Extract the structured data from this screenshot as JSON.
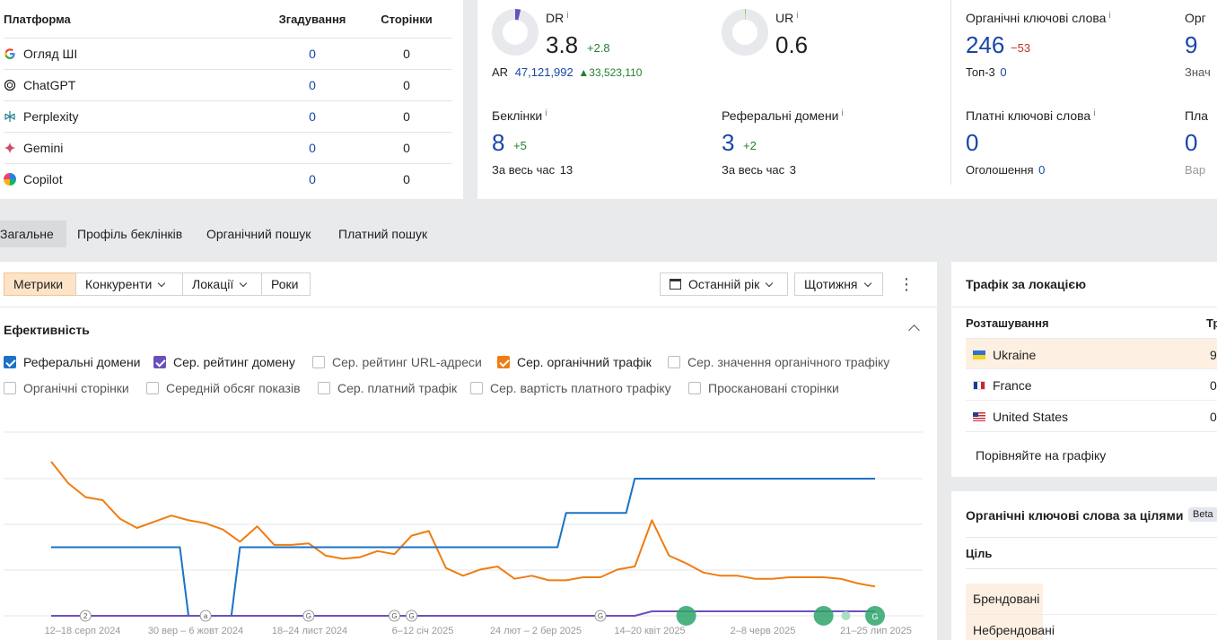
{
  "platforms": {
    "headers": [
      "Платформа",
      "Згадування",
      "Сторінки"
    ],
    "rows": [
      {
        "name": "Огляд ШІ",
        "icon": "google-icon",
        "mentions": "0",
        "pages": "0"
      },
      {
        "name": "ChatGPT",
        "icon": "chatgpt-icon",
        "mentions": "0",
        "pages": "0"
      },
      {
        "name": "Perplexity",
        "icon": "perplexity-icon",
        "mentions": "0",
        "pages": "0"
      },
      {
        "name": "Gemini",
        "icon": "gemini-icon",
        "mentions": "0",
        "pages": "0"
      },
      {
        "name": "Copilot",
        "icon": "copilot-icon",
        "mentions": "0",
        "pages": "0"
      }
    ]
  },
  "metrics": {
    "dr": {
      "label": "DR",
      "info": "i",
      "value": "3.8",
      "delta": "+2.8",
      "fill": 0.038
    },
    "ar": {
      "label": "AR",
      "value": "47,121,992",
      "delta": "▲33,523,110"
    },
    "ur": {
      "label": "UR",
      "info": "i",
      "value": "0.6",
      "fill": 0.006
    },
    "backlinks": {
      "label": "Беклінки",
      "info": "i",
      "value": "8",
      "delta": "+5",
      "sub_label": "За весь час",
      "sub_value": "13"
    },
    "ref_domains": {
      "label": "Реферальні домени",
      "info": "i",
      "value": "3",
      "delta": "+2",
      "sub_label": "За весь час",
      "sub_value": "3"
    },
    "organic_kw": {
      "label": "Органічні ключові слова",
      "info": "i",
      "value": "246",
      "delta": "−53",
      "sub_label": "Топ-3",
      "sub_value": "0"
    },
    "organic_cut": {
      "label": "Орг",
      "value": "9",
      "sub_label": "Знач"
    },
    "paid_kw": {
      "label": "Платні ключові слова",
      "info": "i",
      "value": "0",
      "sub_label": "Оголошення",
      "sub_value": "0"
    },
    "paid_cut": {
      "label": "Пла",
      "value": "0",
      "sub_label": "Вар"
    }
  },
  "tabs": [
    "Загальне",
    "Профіль беклінків",
    "Органічний пошук",
    "Платний пошук"
  ],
  "toolbar": {
    "segments": [
      "Метрики",
      "Конкуренти",
      "Локації",
      "Роки"
    ],
    "period": "Останній рік",
    "interval": "Щотижня"
  },
  "performance": {
    "title": "Ефективність",
    "checkboxes": [
      {
        "label": "Реферальні домени",
        "checked": true,
        "color": "#1a73c8"
      },
      {
        "label": "Сер. рейтинг домену",
        "checked": true,
        "color": "#6c4fbd"
      },
      {
        "label": "Сер. рейтинг URL-адреси",
        "checked": false
      },
      {
        "label": "Сер. органічний трафік",
        "checked": true,
        "color": "#f07c12"
      },
      {
        "label": "Сер. значення органічного трафіку",
        "checked": false
      },
      {
        "label": "Органічні сторінки",
        "checked": false
      },
      {
        "label": "Середній обсяг показів",
        "checked": false
      },
      {
        "label": "Сер. платний трафік",
        "checked": false
      },
      {
        "label": "Сер. вартість платного трафіку",
        "checked": false
      },
      {
        "label": "Проскановані сторінки",
        "checked": false
      }
    ]
  },
  "chart_data": {
    "type": "line",
    "x_tick_labels": [
      "12–18 серп 2024",
      "30 вер – 6 жовт 2024",
      "18–24 лист 2024",
      "6–12 січ 2025",
      "24 лют – 2 бер 2025",
      "14–20 квіт 2025",
      "2–8 черв 2025",
      "21–25 лип 2025"
    ],
    "grid": true,
    "series": [
      {
        "name": "Сер. органічний трафік",
        "color": "#f07c12",
        "values": [
          100,
          86,
          77,
          75,
          63,
          57,
          61,
          65,
          62,
          60,
          56,
          48,
          58,
          46,
          46,
          47,
          39,
          37,
          38,
          42,
          40,
          52,
          55,
          31,
          26,
          30,
          32,
          24,
          26,
          23,
          23,
          25,
          25,
          30,
          32,
          62,
          39,
          34,
          28,
          26,
          26,
          24,
          24,
          25,
          25,
          25,
          24,
          21,
          19
        ]
      },
      {
        "name": "Реферальні домени",
        "color": "#1a73c8",
        "values": [
          2,
          2,
          2,
          2,
          2,
          2,
          2,
          2,
          0,
          0,
          0,
          2,
          2,
          2,
          2,
          2,
          2,
          2,
          2,
          2,
          2,
          2,
          2,
          2,
          2,
          2,
          2,
          2,
          2,
          2,
          3,
          3,
          3,
          3,
          4,
          4,
          4,
          4,
          4,
          4,
          4,
          4,
          4,
          4,
          4,
          4,
          4,
          4,
          4
        ]
      },
      {
        "name": "Сер. рейтинг домену",
        "color": "#6c4fbd",
        "values": [
          0,
          0,
          0,
          0,
          0,
          0,
          0,
          0,
          0,
          0,
          0,
          0,
          0,
          0,
          0,
          0,
          0,
          0,
          0,
          0,
          0,
          0,
          0,
          0,
          0,
          0,
          0,
          0,
          0,
          0,
          0,
          0,
          0,
          0,
          0,
          1,
          1,
          1,
          1,
          1,
          1,
          1,
          1,
          1,
          1,
          1,
          1,
          1,
          1
        ]
      }
    ],
    "events": [
      {
        "label": "2",
        "index": 2
      },
      {
        "label": "a",
        "index": 9
      },
      {
        "label": "G",
        "index": 15
      },
      {
        "label": "G",
        "index": 20
      },
      {
        "label": "G",
        "index": 21
      },
      {
        "label": "G",
        "index": 32
      },
      {
        "label": "",
        "index": 37,
        "big": true
      },
      {
        "label": "",
        "index": 45,
        "big": true
      },
      {
        "label": "G",
        "index": 48,
        "big": true
      }
    ]
  },
  "traffic_location": {
    "title": "Трафік за локацією",
    "col_location": "Розташування",
    "col_traffic": "Тр",
    "rows": [
      {
        "country": "Ukraine",
        "value": "9",
        "highlight": true
      },
      {
        "country": "France",
        "value": "0"
      },
      {
        "country": "United States",
        "value": "0"
      }
    ],
    "compare": "Порівняйте на графіку"
  },
  "intent_keywords": {
    "title": "Органічні ключові слова за цілями",
    "badge": "Beta",
    "col": "Ціль",
    "rows": [
      "Брендовані",
      "Небрендовані"
    ]
  }
}
